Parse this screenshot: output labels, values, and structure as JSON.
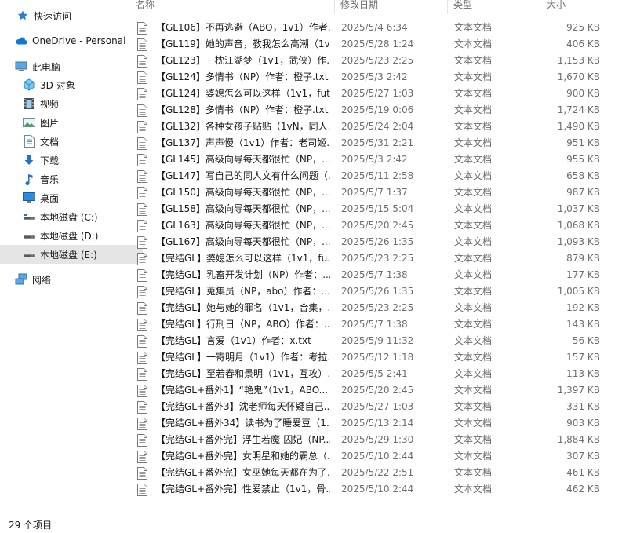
{
  "nav": {
    "items": [
      {
        "label": "快速访问",
        "icon": "star-icon"
      },
      {
        "label": "OneDrive - Personal",
        "icon": "cloud-icon"
      },
      {
        "label": "此电脑",
        "icon": "computer-icon"
      },
      {
        "label": "3D 对象",
        "icon": "3d-objects-icon"
      },
      {
        "label": "视频",
        "icon": "video-icon"
      },
      {
        "label": "图片",
        "icon": "pictures-icon"
      },
      {
        "label": "文档",
        "icon": "documents-icon"
      },
      {
        "label": "下载",
        "icon": "download-icon"
      },
      {
        "label": "音乐",
        "icon": "music-icon"
      },
      {
        "label": "桌面",
        "icon": "desktop-icon"
      },
      {
        "label": "本地磁盘 (C:)",
        "icon": "drive-icon"
      },
      {
        "label": "本地磁盘 (D:)",
        "icon": "drive-icon"
      },
      {
        "label": "本地磁盘 (E:)",
        "icon": "drive-icon",
        "selected": true
      },
      {
        "label": "网络",
        "icon": "network-icon"
      }
    ]
  },
  "columns": {
    "name": "名称",
    "date": "修改日期",
    "type": "类型",
    "size": "大小"
  },
  "files": [
    {
      "name": "【GL106】不再逃避（ABO，1v1）作者...",
      "date": "2025/5/4 6:34",
      "type": "文本文档",
      "size": "925 KB"
    },
    {
      "name": "【GL119】她的声音，教我怎么高潮（1v...",
      "date": "2025/5/28 1:24",
      "type": "文本文档",
      "size": "406 KB"
    },
    {
      "name": "【GL123】一枕江湖梦（1v1，武侠）作...",
      "date": "2025/5/23 2:25",
      "type": "文本文档",
      "size": "1,153 KB"
    },
    {
      "name": "【GL124】多情书（NP）作者：橙子.txt",
      "date": "2025/5/3 2:42",
      "type": "文本文档",
      "size": "1,670 KB"
    },
    {
      "name": "【GL124】婆媳怎么可以这样（1v1，fut...",
      "date": "2025/5/27 1:03",
      "type": "文本文档",
      "size": "900 KB"
    },
    {
      "name": "【GL128】多情书（NP）作者：橙子.txt",
      "date": "2025/5/19 0:06",
      "type": "文本文档",
      "size": "1,724 KB"
    },
    {
      "name": "【GL132】各种女孩子贴贴（1vN，同人...",
      "date": "2025/5/24 2:04",
      "type": "文本文档",
      "size": "1,490 KB"
    },
    {
      "name": "【GL137】声声慢（1v1）作者：老司姬...",
      "date": "2025/5/31 2:21",
      "type": "文本文档",
      "size": "951 KB"
    },
    {
      "name": "【GL145】高级向导每天都很忙（NP，...",
      "date": "2025/5/3 2:42",
      "type": "文本文档",
      "size": "955 KB"
    },
    {
      "name": "【GL147】写自己的同人文有什么问题（...",
      "date": "2025/5/11 2:58",
      "type": "文本文档",
      "size": "658 KB"
    },
    {
      "name": "【GL150】高级向导每天都很忙（NP，...",
      "date": "2025/5/7 1:37",
      "type": "文本文档",
      "size": "987 KB"
    },
    {
      "name": "【GL158】高级向导每天都很忙（NP，...",
      "date": "2025/5/15 5:04",
      "type": "文本文档",
      "size": "1,037 KB"
    },
    {
      "name": "【GL163】高级向导每天都很忙（NP，...",
      "date": "2025/5/20 2:45",
      "type": "文本文档",
      "size": "1,068 KB"
    },
    {
      "name": "【GL167】高级向导每天都很忙（NP，...",
      "date": "2025/5/26 1:35",
      "type": "文本文档",
      "size": "1,093 KB"
    },
    {
      "name": "【完结GL】婆媳怎么可以这样（1v1，fu...",
      "date": "2025/5/23 2:25",
      "type": "文本文档",
      "size": "879 KB"
    },
    {
      "name": "【完结GL】乳畜开发计划（NP）作者：...",
      "date": "2025/5/7 1:38",
      "type": "文本文档",
      "size": "177 KB"
    },
    {
      "name": "【完结GL】蒐集员（NP，abo）作者：...",
      "date": "2025/5/26 1:35",
      "type": "文本文档",
      "size": "1,005 KB"
    },
    {
      "name": "【完结GL】她与她的罪名（1v1，合集，...",
      "date": "2025/5/23 2:25",
      "type": "文本文档",
      "size": "192 KB"
    },
    {
      "name": "【完结GL】行刑日（NP，ABO）作者：...",
      "date": "2025/5/7 1:38",
      "type": "文本文档",
      "size": "143 KB"
    },
    {
      "name": "【完结GL】言爱（1v1）作者：x.txt",
      "date": "2025/5/9 11:32",
      "type": "文本文档",
      "size": "56 KB"
    },
    {
      "name": "【完结GL】一寄明月（1v1）作者：考拉...",
      "date": "2025/5/12 1:18",
      "type": "文本文档",
      "size": "157 KB"
    },
    {
      "name": "【完结GL】至若春和景明（1v1，互攻）...",
      "date": "2025/5/5 2:41",
      "type": "文本文档",
      "size": "113 KB"
    },
    {
      "name": "【完结GL+番外1】“艳鬼”（1v1，ABO...",
      "date": "2025/5/20 2:45",
      "type": "文本文档",
      "size": "1,397 KB"
    },
    {
      "name": "【完结GL+番外3】沈老师每天怀疑自己...",
      "date": "2025/5/27 1:03",
      "type": "文本文档",
      "size": "331 KB"
    },
    {
      "name": "【完结GL+番外34】读书为了睡爱豆（1...",
      "date": "2025/5/13 2:14",
      "type": "文本文档",
      "size": "903 KB"
    },
    {
      "name": "【完结GL+番外完】浮生若魔-囚妃（NP...",
      "date": "2025/5/29 1:30",
      "type": "文本文档",
      "size": "1,884 KB"
    },
    {
      "name": "【完结GL+番外完】女明星和她的霸总（...",
      "date": "2025/5/10 2:44",
      "type": "文本文档",
      "size": "307 KB"
    },
    {
      "name": "【完结GL+番外完】女巫她每天都在为了...",
      "date": "2025/5/22 2:51",
      "type": "文本文档",
      "size": "461 KB"
    },
    {
      "name": "【完结GL+番外完】性爱禁止（1v1，骨...",
      "date": "2025/5/10 2:44",
      "type": "文本文档",
      "size": "462 KB"
    }
  ],
  "status": {
    "count": "29 个项目"
  }
}
